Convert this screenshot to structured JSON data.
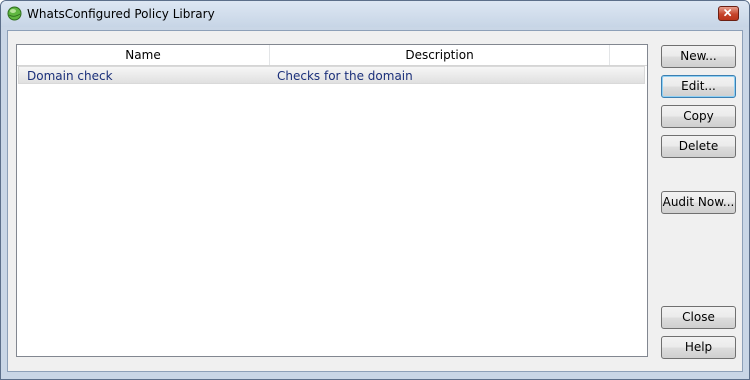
{
  "window": {
    "title": "WhatsConfigured Policy Library"
  },
  "list": {
    "columns": [
      "Name",
      "Description"
    ],
    "rows": [
      {
        "name": "Domain check",
        "description": "Checks for the domain"
      }
    ]
  },
  "buttons": {
    "new": "New...",
    "edit": "Edit...",
    "copy": "Copy",
    "delete": "Delete",
    "audit_now": "Audit Now...",
    "close": "Close",
    "help": "Help"
  },
  "icons": {
    "app": "green-globe-icon",
    "close": "close-icon"
  },
  "colors": {
    "title_bar": "#c7d5e6",
    "close_button": "#c6452c",
    "list_text": "#1a2f7a"
  }
}
